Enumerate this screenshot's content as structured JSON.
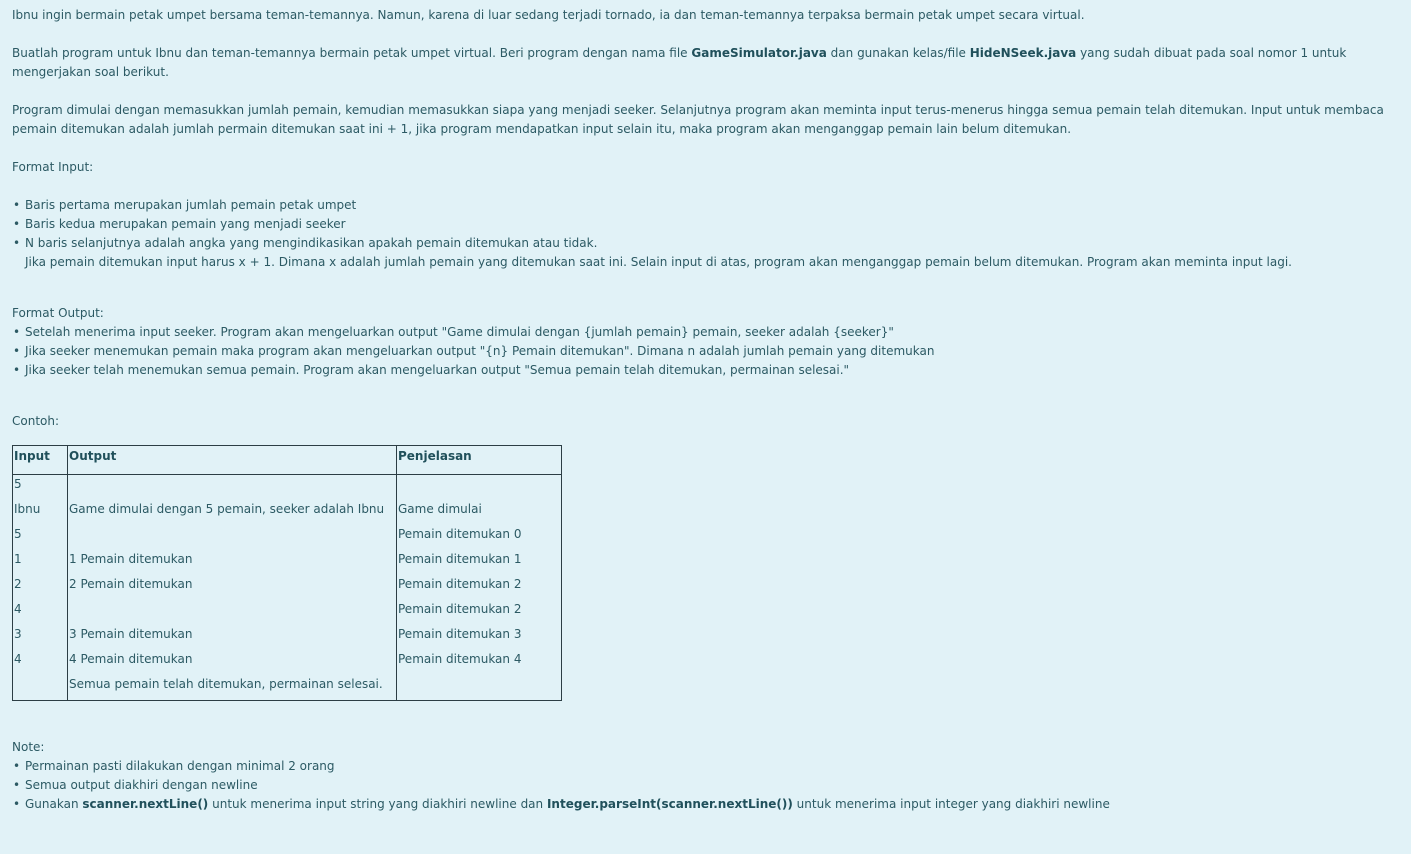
{
  "intro": {
    "p1": "Ibnu ingin bermain petak umpet bersama teman-temannya. Namun, karena di luar sedang terjadi tornado, ia dan teman-temannya terpaksa bermain petak umpet secara virtual.",
    "p2_before": "Buatlah program untuk Ibnu dan teman-temannya bermain petak umpet virtual. Beri program dengan nama file ",
    "p2_file1": "GameSimulator.java",
    "p2_mid": " dan gunakan kelas/file ",
    "p2_file2": "HideNSeek.java",
    "p2_after": " yang sudah dibuat pada soal nomor 1 untuk mengerjakan soal berikut.",
    "p3": "Program dimulai dengan memasukkan jumlah pemain, kemudian memasukkan siapa yang menjadi seeker. Selanjutnya program akan meminta input terus-menerus hingga semua pemain telah ditemukan. Input untuk membaca pemain ditemukan adalah jumlah permain ditemukan saat ini + 1, jika program mendapatkan input selain itu, maka program akan menganggap pemain lain belum ditemukan."
  },
  "format_input": {
    "heading": "Format Input:",
    "items": [
      "Baris pertama merupakan jumlah pemain petak umpet",
      "Baris kedua merupakan pemain yang menjadi seeker",
      "N baris selanjutnya adalah angka yang mengindikasikan apakah pemain ditemukan atau tidak."
    ],
    "continuation": "Jika pemain ditemukan input harus x + 1. Dimana x adalah jumlah pemain yang ditemukan saat ini. Selain input di atas, program akan menganggap pemain belum ditemukan. Program akan meminta input lagi."
  },
  "format_output": {
    "heading": "Format Output:",
    "items": [
      "Setelah menerima input seeker. Program akan mengeluarkan output \"Game dimulai dengan {jumlah pemain} pemain, seeker adalah {seeker}\"",
      "Jika seeker menemukan pemain maka program akan mengeluarkan output \"{n} Pemain ditemukan\". Dimana n adalah jumlah pemain yang ditemukan",
      "Jika seeker telah menemukan semua pemain. Program akan mengeluarkan output \"Semua pemain telah ditemukan, permainan selesai.\""
    ]
  },
  "example": {
    "heading": "Contoh:",
    "columns": [
      "Input",
      "Output",
      "Penjelasan"
    ],
    "input_lines": [
      "5",
      "Ibnu",
      "5",
      "1",
      "2",
      "4",
      "3",
      "4",
      ""
    ],
    "output_lines": [
      "",
      "Game dimulai dengan 5 pemain, seeker adalah Ibnu",
      "",
      "1 Pemain ditemukan",
      "2 Pemain ditemukan",
      "",
      "3 Pemain ditemukan",
      "4 Pemain ditemukan",
      "Semua pemain telah ditemukan, permainan selesai."
    ],
    "explanation_lines": [
      "",
      "Game dimulai",
      "Pemain ditemukan 0",
      "Pemain ditemukan 1",
      "Pemain ditemukan 2",
      "Pemain ditemukan 2",
      "Pemain ditemukan 3",
      "Pemain ditemukan 4",
      ""
    ]
  },
  "note": {
    "heading": "Note:",
    "item1": "Permainan pasti dilakukan dengan minimal 2 orang",
    "item2": "Semua output diakhiri dengan newline",
    "item3_pre": "Gunakan ",
    "item3_code1": "scanner.nextLine()",
    "item3_mid": " untuk menerima input string yang diakhiri newline dan ",
    "item3_code2": "Integer.parseInt(scanner.nextLine())",
    "item3_post": " untuk menerima input integer yang diakhiri newline"
  }
}
